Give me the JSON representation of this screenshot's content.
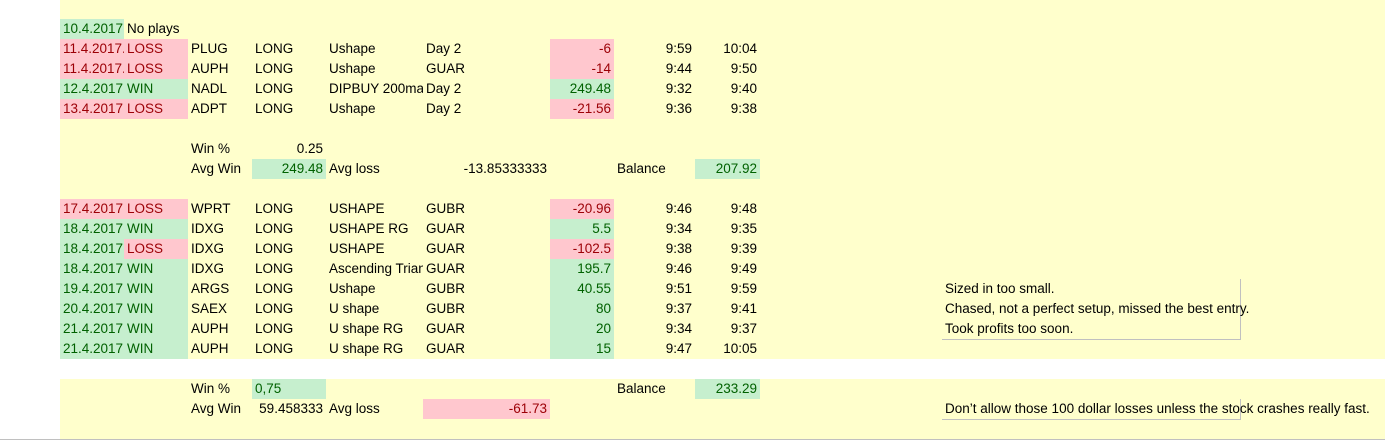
{
  "colors": {
    "sheet_fill": "#ffffcc",
    "win_fill": "#c6efce",
    "win_text": "#006100",
    "loss_fill": "#ffc7ce",
    "loss_text": "#9c0006"
  },
  "rows": [
    {
      "cells": []
    },
    {
      "cells": [
        {
          "c": 1,
          "t": "10.4.2017.",
          "s": "g"
        },
        {
          "c": 2,
          "t": "No plays"
        }
      ]
    },
    {
      "cells": [
        {
          "c": 1,
          "t": "11.4.2017.",
          "s": "r"
        },
        {
          "c": 2,
          "t": "LOSS",
          "s": "r"
        },
        {
          "c": 3,
          "t": "PLUG"
        },
        {
          "c": 4,
          "t": "LONG"
        },
        {
          "c": 5,
          "t": "Ushape"
        },
        {
          "c": 6,
          "t": "Day 2"
        },
        {
          "c": 7,
          "t": "-6",
          "s": "r n"
        },
        {
          "c": 8,
          "t": "9:59",
          "s": "n"
        },
        {
          "c": 9,
          "t": "10:04",
          "s": "n"
        }
      ]
    },
    {
      "cells": [
        {
          "c": 1,
          "t": "11.4.2017.",
          "s": "r"
        },
        {
          "c": 2,
          "t": "LOSS",
          "s": "r"
        },
        {
          "c": 3,
          "t": "AUPH"
        },
        {
          "c": 4,
          "t": "LONG"
        },
        {
          "c": 5,
          "t": "Ushape"
        },
        {
          "c": 6,
          "t": "GUAR"
        },
        {
          "c": 7,
          "t": "-14",
          "s": "r n"
        },
        {
          "c": 8,
          "t": "9:44",
          "s": "n"
        },
        {
          "c": 9,
          "t": "9:50",
          "s": "n"
        }
      ]
    },
    {
      "cells": [
        {
          "c": 1,
          "t": "12.4.2017.",
          "s": "g"
        },
        {
          "c": 2,
          "t": "WIN",
          "s": "g"
        },
        {
          "c": 3,
          "t": "NADL"
        },
        {
          "c": 4,
          "t": "LONG"
        },
        {
          "c": 5,
          "t": "DIPBUY 200ma"
        },
        {
          "c": 6,
          "t": "Day 2"
        },
        {
          "c": 7,
          "t": "249.48",
          "s": "g n"
        },
        {
          "c": 8,
          "t": "9:32",
          "s": "n"
        },
        {
          "c": 9,
          "t": "9:40",
          "s": "n"
        }
      ]
    },
    {
      "cells": [
        {
          "c": 1,
          "t": "13.4.2017.",
          "s": "r"
        },
        {
          "c": 2,
          "t": "LOSS",
          "s": "r"
        },
        {
          "c": 3,
          "t": "ADPT"
        },
        {
          "c": 4,
          "t": "LONG"
        },
        {
          "c": 5,
          "t": "Ushape"
        },
        {
          "c": 6,
          "t": "Day 2"
        },
        {
          "c": 7,
          "t": "-21.56",
          "s": "r n"
        },
        {
          "c": 8,
          "t": "9:36",
          "s": "n"
        },
        {
          "c": 9,
          "t": "9:38",
          "s": "n"
        }
      ]
    },
    {
      "cells": []
    },
    {
      "cells": [
        {
          "c": 3,
          "t": "Win %"
        },
        {
          "c": 4,
          "t": "0.25",
          "s": "n"
        }
      ]
    },
    {
      "cells": [
        {
          "c": 3,
          "t": "Avg Win"
        },
        {
          "c": 4,
          "t": "249.48",
          "s": "g n"
        },
        {
          "c": 5,
          "t": "Avg loss"
        },
        {
          "c": 6,
          "t": "-13.85333333",
          "s": "n"
        },
        {
          "c": 8,
          "t": "Balance"
        },
        {
          "c": 9,
          "t": "207.92",
          "s": "g n"
        }
      ]
    },
    {
      "cells": []
    },
    {
      "cells": [
        {
          "c": 1,
          "t": "17.4.2017.",
          "s": "r"
        },
        {
          "c": 2,
          "t": "LOSS",
          "s": "r"
        },
        {
          "c": 3,
          "t": "WPRT"
        },
        {
          "c": 4,
          "t": "LONG"
        },
        {
          "c": 5,
          "t": "USHAPE"
        },
        {
          "c": 6,
          "t": "GUBR"
        },
        {
          "c": 7,
          "t": "-20.96",
          "s": "r n"
        },
        {
          "c": 8,
          "t": "9:46",
          "s": "n"
        },
        {
          "c": 9,
          "t": "9:48",
          "s": "n"
        }
      ]
    },
    {
      "cells": [
        {
          "c": 1,
          "t": "18.4.2017.",
          "s": "g"
        },
        {
          "c": 2,
          "t": "WIN",
          "s": "g"
        },
        {
          "c": 3,
          "t": "IDXG"
        },
        {
          "c": 4,
          "t": "LONG"
        },
        {
          "c": 5,
          "t": "USHAPE RG"
        },
        {
          "c": 6,
          "t": "GUAR"
        },
        {
          "c": 7,
          "t": "5.5",
          "s": "g n"
        },
        {
          "c": 8,
          "t": "9:34",
          "s": "n"
        },
        {
          "c": 9,
          "t": "9:35",
          "s": "n"
        }
      ]
    },
    {
      "cells": [
        {
          "c": 1,
          "t": "18.4.2017.",
          "s": "g"
        },
        {
          "c": 2,
          "t": "LOSS",
          "s": "r"
        },
        {
          "c": 3,
          "t": "IDXG"
        },
        {
          "c": 4,
          "t": "LONG"
        },
        {
          "c": 5,
          "t": "USHAPE"
        },
        {
          "c": 6,
          "t": "GUAR"
        },
        {
          "c": 7,
          "t": "-102.5",
          "s": "r n"
        },
        {
          "c": 8,
          "t": "9:38",
          "s": "n"
        },
        {
          "c": 9,
          "t": "9:39",
          "s": "n"
        }
      ]
    },
    {
      "cells": [
        {
          "c": 1,
          "t": "18.4.2017.",
          "s": "g"
        },
        {
          "c": 2,
          "t": "WIN",
          "s": "g"
        },
        {
          "c": 3,
          "t": "IDXG"
        },
        {
          "c": 4,
          "t": "LONG"
        },
        {
          "c": 5,
          "t": "Ascending Triangle"
        },
        {
          "c": 6,
          "t": "GUAR"
        },
        {
          "c": 7,
          "t": "195.7",
          "s": "g n"
        },
        {
          "c": 8,
          "t": "9:46",
          "s": "n"
        },
        {
          "c": 9,
          "t": "9:49",
          "s": "n"
        }
      ]
    },
    {
      "cells": [
        {
          "c": 1,
          "t": "19.4.2017.",
          "s": "g"
        },
        {
          "c": 2,
          "t": "WIN",
          "s": "g"
        },
        {
          "c": 3,
          "t": "ARGS"
        },
        {
          "c": 4,
          "t": "LONG"
        },
        {
          "c": 5,
          "t": "Ushape"
        },
        {
          "c": 6,
          "t": "GUBR"
        },
        {
          "c": 7,
          "t": "40.55",
          "s": "g n"
        },
        {
          "c": 8,
          "t": "9:51",
          "s": "n"
        },
        {
          "c": 9,
          "t": "9:59",
          "s": "n"
        },
        {
          "c": 12,
          "t": "Sized in too small.",
          "s": "ov"
        }
      ]
    },
    {
      "cells": [
        {
          "c": 1,
          "t": "20.4.2017.",
          "s": "g"
        },
        {
          "c": 2,
          "t": "WIN",
          "s": "g"
        },
        {
          "c": 3,
          "t": "SAEX"
        },
        {
          "c": 4,
          "t": "LONG"
        },
        {
          "c": 5,
          "t": "U shape"
        },
        {
          "c": 6,
          "t": "GUBR"
        },
        {
          "c": 7,
          "t": "80",
          "s": "g n"
        },
        {
          "c": 8,
          "t": "9:37",
          "s": "n"
        },
        {
          "c": 9,
          "t": "9:41",
          "s": "n"
        },
        {
          "c": 12,
          "t": "Chased, not a perfect setup, missed the best entry.",
          "s": "ov"
        }
      ]
    },
    {
      "cells": [
        {
          "c": 1,
          "t": "21.4.2017.",
          "s": "g"
        },
        {
          "c": 2,
          "t": "WIN",
          "s": "g"
        },
        {
          "c": 3,
          "t": "AUPH"
        },
        {
          "c": 4,
          "t": "LONG"
        },
        {
          "c": 5,
          "t": "U shape RG"
        },
        {
          "c": 6,
          "t": "GUAR"
        },
        {
          "c": 7,
          "t": "20",
          "s": "g n"
        },
        {
          "c": 8,
          "t": "9:34",
          "s": "n"
        },
        {
          "c": 9,
          "t": "9:37",
          "s": "n"
        },
        {
          "c": 12,
          "t": "Took profits too soon.",
          "s": "ov"
        }
      ]
    },
    {
      "cells": [
        {
          "c": 1,
          "t": "21.4.2017.",
          "s": "g"
        },
        {
          "c": 2,
          "t": "WIN",
          "s": "g"
        },
        {
          "c": 3,
          "t": "AUPH"
        },
        {
          "c": 4,
          "t": "LONG"
        },
        {
          "c": 5,
          "t": "U shape RG"
        },
        {
          "c": 6,
          "t": "GUAR"
        },
        {
          "c": 7,
          "t": "15",
          "s": "g n"
        },
        {
          "c": 8,
          "t": "9:47",
          "s": "n"
        },
        {
          "c": 9,
          "t": "10:05",
          "s": "n"
        }
      ]
    },
    {
      "cells": [],
      "white": true
    },
    {
      "cells": [
        {
          "c": 3,
          "t": "Win %"
        },
        {
          "c": 4,
          "t": "0,75",
          "s": "g"
        },
        {
          "c": 8,
          "t": "Balance"
        },
        {
          "c": 9,
          "t": "233.29",
          "s": "g n"
        }
      ]
    },
    {
      "cells": [
        {
          "c": 3,
          "t": "Avg Win"
        },
        {
          "c": 4,
          "t": "59.458333",
          "s": "n"
        },
        {
          "c": 5,
          "t": "Avg loss"
        },
        {
          "c": 6,
          "t": "-61.73",
          "s": "r n"
        },
        {
          "c": 12,
          "t": "Don’t allow those 100 dollar losses unless the stock crashes really fast.",
          "s": "ov"
        }
      ]
    },
    {
      "cells": []
    }
  ]
}
